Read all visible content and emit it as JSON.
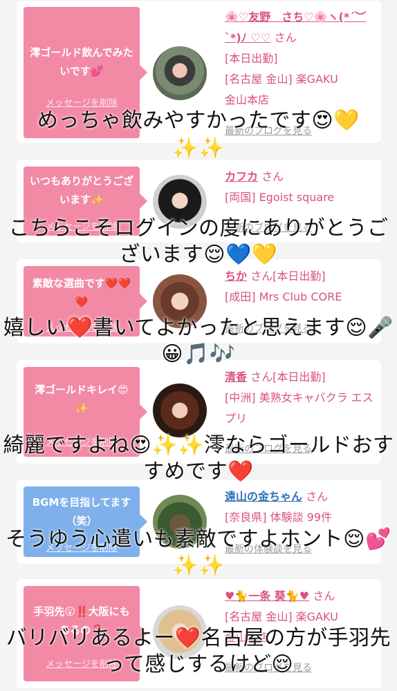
{
  "entries": [
    {
      "bubble": "澪ゴールド飲んでみたいです💕",
      "bubble_del": "メッセージを削除",
      "name": "🌸♡友野　さち♡🌸ヽ(*´︶`*)ﾉ ♡♡",
      "san": "さん",
      "lines": [
        "[本日出勤]",
        "[名古屋 金山] 楽GAKU",
        "金山本店"
      ],
      "more": "最新のブログを見る",
      "overlay": "めっちゃ飲みやすかったです😍💛",
      "overlay2": "✨✨",
      "color": "#f28aa5"
    },
    {
      "bubble": "いつもありがとうございます✨",
      "bubble_del": "メッセージを削除",
      "name": "カフカ",
      "san": "さん",
      "lines": [
        "[両国] Egoist square"
      ],
      "more": "最新のブログを見る",
      "overlay": "こちらこそログインの度にありがとうございます😌💙💛",
      "color": "#f28aa5"
    },
    {
      "bubble": "素敵な選曲です❤️❤️❤️",
      "bubble_del": "メッセージを削除",
      "name": "ちか",
      "san": "さん[本日出勤]",
      "lines": [
        "[成田] Mrs Club CORE"
      ],
      "more": "最新のブログを見る",
      "overlay": "嬉しい❤️書いてよかったと思えます😌🎤😀🎵🎶",
      "color": "#f28aa5"
    },
    {
      "bubble": "澪ゴールドキレイ😍✨",
      "bubble_del": "メッセージを削除",
      "name": "清香",
      "san": "さん[本日出勤]",
      "lines": [
        "[中洲] 美熟女キャバクラ エスプリ"
      ],
      "more": "最新のブログを見る",
      "overlay": "綺麗ですよね😍✨✨澪ならゴールドおすすめです❤️",
      "color": "#f28aa5"
    },
    {
      "bubble": "BGMを目指してます（笑）",
      "bubble_del": "メッセージを削除",
      "name": "遠山の金ちゃん",
      "san": "さん",
      "lines": [
        "[奈良県] 体験談 99件"
      ],
      "more": "最新の体験談を見る",
      "overlay": "そうゆう心遣いも素敵ですよホント😌💕✨✨",
      "color": "#7fb0ec"
    },
    {
      "bubble": "手羽先😮‼️大阪にもあるの❓",
      "bubble_del": "メッセージを削除",
      "name": "♥🐈一条 葵🐈♥",
      "san": "さん",
      "lines": [
        "[名古屋 金山] 楽GAKU",
        "金山本店"
      ],
      "more": "最新のブログを見る",
      "overlay": "バリバリあるよー❤️名古屋の方が手羽先って感じするけど😌",
      "color": "#f28aa5"
    }
  ]
}
